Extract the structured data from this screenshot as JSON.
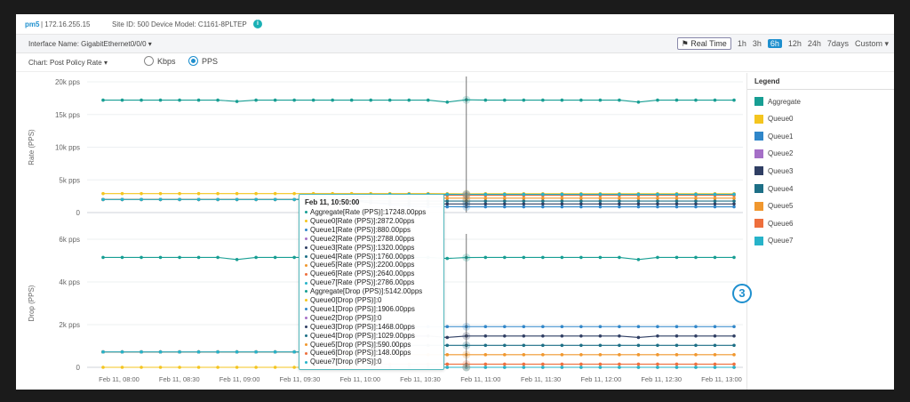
{
  "header": {
    "hostname": "pm5",
    "ip": "| 172.16.255.15",
    "site": "Site ID: 500",
    "model": "Device Model: C1161-8PLTEP",
    "info_icon": "i"
  },
  "toolbar": {
    "interface_label": "Interface Name: GigabitEthernet0/0/0",
    "realtime_label": "Real Time",
    "time_ranges": [
      "1h",
      "3h",
      "6h",
      "12h",
      "24h",
      "7days",
      "Custom"
    ],
    "active_range": "6h"
  },
  "chartbar": {
    "chart_label": "Chart: Post Policy Rate",
    "radio_kbps": "Kbps",
    "radio_pps": "PPS",
    "selected_unit": "PPS"
  },
  "legend": {
    "title": "Legend",
    "items": [
      {
        "label": "Aggregate",
        "color": "#179e93"
      },
      {
        "label": "Queue0",
        "color": "#f4c51f"
      },
      {
        "label": "Queue1",
        "color": "#2f86c9"
      },
      {
        "label": "Queue2",
        "color": "#a56fc7"
      },
      {
        "label": "Queue3",
        "color": "#2f3e63"
      },
      {
        "label": "Queue4",
        "color": "#1d6f86"
      },
      {
        "label": "Queue5",
        "color": "#f0972e"
      },
      {
        "label": "Queue6",
        "color": "#ee6f3d"
      },
      {
        "label": "Queue7",
        "color": "#27b3c9"
      }
    ]
  },
  "badge": "3",
  "tooltip": {
    "time": "Feb 11, 10:50:00",
    "rows": [
      {
        "text": "Aggregate[Rate (PPS)]:17248.00pps",
        "color": "#179e93"
      },
      {
        "text": "Queue0[Rate (PPS)]:2872.00pps",
        "color": "#f4c51f"
      },
      {
        "text": "Queue1[Rate (PPS)]:880.00pps",
        "color": "#2f86c9"
      },
      {
        "text": "Queue2[Rate (PPS)]:2788.00pps",
        "color": "#a56fc7"
      },
      {
        "text": "Queue3[Rate (PPS)]:1320.00pps",
        "color": "#2f3e63"
      },
      {
        "text": "Queue4[Rate (PPS)]:1760.00pps",
        "color": "#1d6f86"
      },
      {
        "text": "Queue5[Rate (PPS)]:2200.00pps",
        "color": "#f0972e"
      },
      {
        "text": "Queue6[Rate (PPS)]:2640.00pps",
        "color": "#ee6f3d"
      },
      {
        "text": "Queue7[Rate (PPS)]:2786.00pps",
        "color": "#27b3c9"
      },
      {
        "text": "Aggregate[Drop (PPS)]:5142.00pps",
        "color": "#179e93"
      },
      {
        "text": "Queue0[Drop (PPS)]:0",
        "color": "#f4c51f"
      },
      {
        "text": "Queue1[Drop (PPS)]:1906.00pps",
        "color": "#2f86c9"
      },
      {
        "text": "Queue2[Drop (PPS)]:0",
        "color": "#a56fc7"
      },
      {
        "text": "Queue3[Drop (PPS)]:1468.00pps",
        "color": "#2f3e63"
      },
      {
        "text": "Queue4[Drop (PPS)]:1029.00pps",
        "color": "#1d6f86"
      },
      {
        "text": "Queue5[Drop (PPS)]:590.00pps",
        "color": "#f0972e"
      },
      {
        "text": "Queue6[Drop (PPS)]:148.00pps",
        "color": "#ee6f3d"
      },
      {
        "text": "Queue7[Drop (PPS)]:0",
        "color": "#27b3c9"
      }
    ]
  },
  "chart_data": [
    {
      "type": "line",
      "ylabel": "Rate (PPS)",
      "yticks": [
        "20k pps",
        "15k pps",
        "10k pps",
        "5k pps",
        "0"
      ],
      "ylim": [
        0,
        20000
      ],
      "hover_index": 19,
      "series": [
        {
          "name": "Aggregate",
          "color": "#179e93",
          "values": [
            17200,
            17200,
            17200,
            17200,
            17200,
            17200,
            17200,
            17000,
            17200,
            17200,
            17200,
            17200,
            17200,
            17200,
            17200,
            17200,
            17200,
            17200,
            16900,
            17248,
            17200,
            17200,
            17200,
            17200,
            17200,
            17200,
            17200,
            17200,
            16900,
            17200,
            17200,
            17200,
            17200,
            17200
          ]
        },
        {
          "name": "Queue0",
          "color": "#f4c51f",
          "values": [
            2900,
            2900,
            2900,
            2900,
            2900,
            2900,
            2900,
            2900,
            2900,
            2900,
            2900,
            2900,
            2900,
            2900,
            2900,
            2900,
            2900,
            2900,
            2880,
            2872,
            2880,
            2880,
            2880,
            2880,
            2880,
            2880,
            2880,
            2880,
            2880,
            2880,
            2880,
            2880,
            2880,
            2880
          ]
        },
        {
          "name": "Queue1",
          "color": "#2f86c9",
          "values": [
            2000,
            2000,
            2000,
            2000,
            2000,
            2000,
            2000,
            2000,
            2000,
            2000,
            2000,
            2000,
            2000,
            1900,
            1500,
            1200,
            1000,
            900,
            890,
            880,
            880,
            880,
            880,
            880,
            880,
            880,
            880,
            880,
            880,
            880,
            880,
            880,
            880,
            880
          ]
        },
        {
          "name": "Queue2",
          "color": "#a56fc7",
          "values": [
            2000,
            2000,
            2000,
            2000,
            2000,
            2000,
            2000,
            2000,
            2000,
            2000,
            2000,
            2000,
            2000,
            2200,
            2500,
            2700,
            2780,
            2788,
            2788,
            2788,
            2788,
            2788,
            2788,
            2788,
            2788,
            2788,
            2788,
            2788,
            2788,
            2788,
            2788,
            2788,
            2788,
            2788
          ]
        },
        {
          "name": "Queue3",
          "color": "#2f3e63",
          "values": [
            2000,
            2000,
            2000,
            2000,
            2000,
            2000,
            2000,
            2000,
            2000,
            2000,
            2000,
            2000,
            2000,
            1800,
            1500,
            1400,
            1330,
            1320,
            1320,
            1320,
            1320,
            1320,
            1320,
            1320,
            1320,
            1320,
            1320,
            1320,
            1320,
            1320,
            1320,
            1320,
            1320,
            1320
          ]
        },
        {
          "name": "Queue4",
          "color": "#1d6f86",
          "values": [
            2000,
            2000,
            2000,
            2000,
            2000,
            2000,
            2000,
            2000,
            2000,
            2000,
            2000,
            2000,
            2000,
            1900,
            1800,
            1770,
            1760,
            1760,
            1760,
            1760,
            1760,
            1760,
            1760,
            1760,
            1760,
            1760,
            1760,
            1760,
            1760,
            1760,
            1760,
            1760,
            1760,
            1760
          ]
        },
        {
          "name": "Queue5",
          "color": "#f0972e",
          "values": [
            2000,
            2000,
            2000,
            2000,
            2000,
            2000,
            2000,
            2000,
            2000,
            2000,
            2000,
            2000,
            2000,
            2100,
            2200,
            2200,
            2200,
            2200,
            2200,
            2200,
            2200,
            2200,
            2200,
            2200,
            2200,
            2200,
            2200,
            2200,
            2200,
            2200,
            2200,
            2200,
            2200,
            2200
          ]
        },
        {
          "name": "Queue6",
          "color": "#ee6f3d",
          "values": [
            2000,
            2000,
            2000,
            2000,
            2000,
            2000,
            2000,
            2000,
            2000,
            2000,
            2000,
            2000,
            2000,
            2300,
            2550,
            2630,
            2640,
            2640,
            2640,
            2640,
            2640,
            2640,
            2640,
            2640,
            2640,
            2640,
            2640,
            2640,
            2640,
            2640,
            2640,
            2640,
            2640,
            2640
          ]
        },
        {
          "name": "Queue7",
          "color": "#27b3c9",
          "values": [
            2000,
            2000,
            2000,
            2000,
            2000,
            2000,
            2000,
            2000,
            2000,
            2000,
            2000,
            2000,
            2000,
            2400,
            2700,
            2780,
            2786,
            2786,
            2786,
            2786,
            2786,
            2786,
            2786,
            2786,
            2786,
            2786,
            2786,
            2786,
            2786,
            2786,
            2786,
            2786,
            2786,
            2786
          ]
        }
      ]
    },
    {
      "type": "line",
      "ylabel": "Drop (PPS)",
      "yticks": [
        "6k pps",
        "4k pps",
        "2k pps",
        "0"
      ],
      "ylim": [
        0,
        6000
      ],
      "hover_index": 19,
      "x": [
        "Feb 11, 08:00",
        "Feb 11, 08:30",
        "Feb 11, 09:00",
        "Feb 11, 09:30",
        "Feb 11, 10:00",
        "Feb 11, 10:30",
        "Feb 11, 11:00",
        "Feb 11, 11:30",
        "Feb 11, 12:00",
        "Feb 11, 12:30",
        "Feb 11, 13:00"
      ],
      "series": [
        {
          "name": "Aggregate",
          "color": "#179e93",
          "values": [
            5150,
            5150,
            5150,
            5150,
            5150,
            5150,
            5150,
            5050,
            5150,
            5150,
            5150,
            5150,
            5150,
            5150,
            5150,
            5150,
            5150,
            5150,
            5100,
            5142,
            5150,
            5150,
            5150,
            5150,
            5150,
            5150,
            5150,
            5150,
            5050,
            5150,
            5150,
            5150,
            5150,
            5150
          ]
        },
        {
          "name": "Queue0",
          "color": "#f4c51f",
          "values": [
            0,
            0,
            0,
            0,
            0,
            0,
            0,
            0,
            0,
            0,
            0,
            0,
            0,
            0,
            0,
            0,
            0,
            0,
            0,
            0,
            0,
            0,
            0,
            0,
            0,
            0,
            0,
            0,
            0,
            0,
            0,
            0,
            0,
            0
          ]
        },
        {
          "name": "Queue1",
          "color": "#2f86c9",
          "values": [
            720,
            720,
            720,
            720,
            720,
            720,
            720,
            720,
            720,
            720,
            720,
            720,
            720,
            1300,
            1906,
            1906,
            1906,
            1906,
            1906,
            1906,
            1906,
            1906,
            1906,
            1906,
            1906,
            1906,
            1906,
            1906,
            1906,
            1906,
            1906,
            1906,
            1906,
            1906
          ]
        },
        {
          "name": "Queue2",
          "color": "#a56fc7",
          "values": [
            720,
            720,
            720,
            720,
            720,
            720,
            720,
            720,
            720,
            720,
            720,
            720,
            720,
            380,
            30,
            0,
            0,
            0,
            0,
            0,
            0,
            0,
            0,
            0,
            0,
            0,
            0,
            0,
            0,
            0,
            0,
            0,
            0,
            0
          ]
        },
        {
          "name": "Queue3",
          "color": "#2f3e63",
          "values": [
            720,
            720,
            720,
            720,
            720,
            720,
            720,
            720,
            720,
            720,
            720,
            720,
            720,
            1100,
            1468,
            1468,
            1468,
            1468,
            1400,
            1468,
            1468,
            1468,
            1468,
            1468,
            1468,
            1468,
            1468,
            1468,
            1400,
            1468,
            1468,
            1468,
            1468,
            1468
          ]
        },
        {
          "name": "Queue4",
          "color": "#1d6f86",
          "values": [
            720,
            720,
            720,
            720,
            720,
            720,
            720,
            720,
            720,
            720,
            720,
            720,
            720,
            880,
            1029,
            1029,
            1029,
            1029,
            1029,
            1029,
            1029,
            1029,
            1029,
            1029,
            1029,
            1029,
            1029,
            1029,
            1029,
            1029,
            1029,
            1029,
            1029,
            1029
          ]
        },
        {
          "name": "Queue5",
          "color": "#f0972e",
          "values": [
            720,
            720,
            720,
            720,
            720,
            720,
            720,
            720,
            720,
            720,
            720,
            720,
            720,
            650,
            590,
            590,
            590,
            590,
            590,
            590,
            590,
            590,
            590,
            590,
            590,
            590,
            590,
            590,
            590,
            590,
            590,
            590,
            590,
            590
          ]
        },
        {
          "name": "Queue6",
          "color": "#ee6f3d",
          "values": [
            720,
            720,
            720,
            720,
            720,
            720,
            720,
            720,
            720,
            720,
            720,
            720,
            720,
            400,
            148,
            148,
            148,
            148,
            148,
            148,
            148,
            148,
            148,
            148,
            148,
            148,
            148,
            148,
            148,
            148,
            148,
            148,
            148,
            148
          ]
        },
        {
          "name": "Queue7",
          "color": "#27b3c9",
          "values": [
            720,
            720,
            720,
            720,
            720,
            720,
            720,
            720,
            720,
            720,
            720,
            720,
            720,
            380,
            0,
            0,
            0,
            0,
            0,
            0,
            0,
            0,
            0,
            0,
            0,
            0,
            0,
            0,
            0,
            0,
            0,
            0,
            0,
            0
          ]
        }
      ]
    }
  ]
}
